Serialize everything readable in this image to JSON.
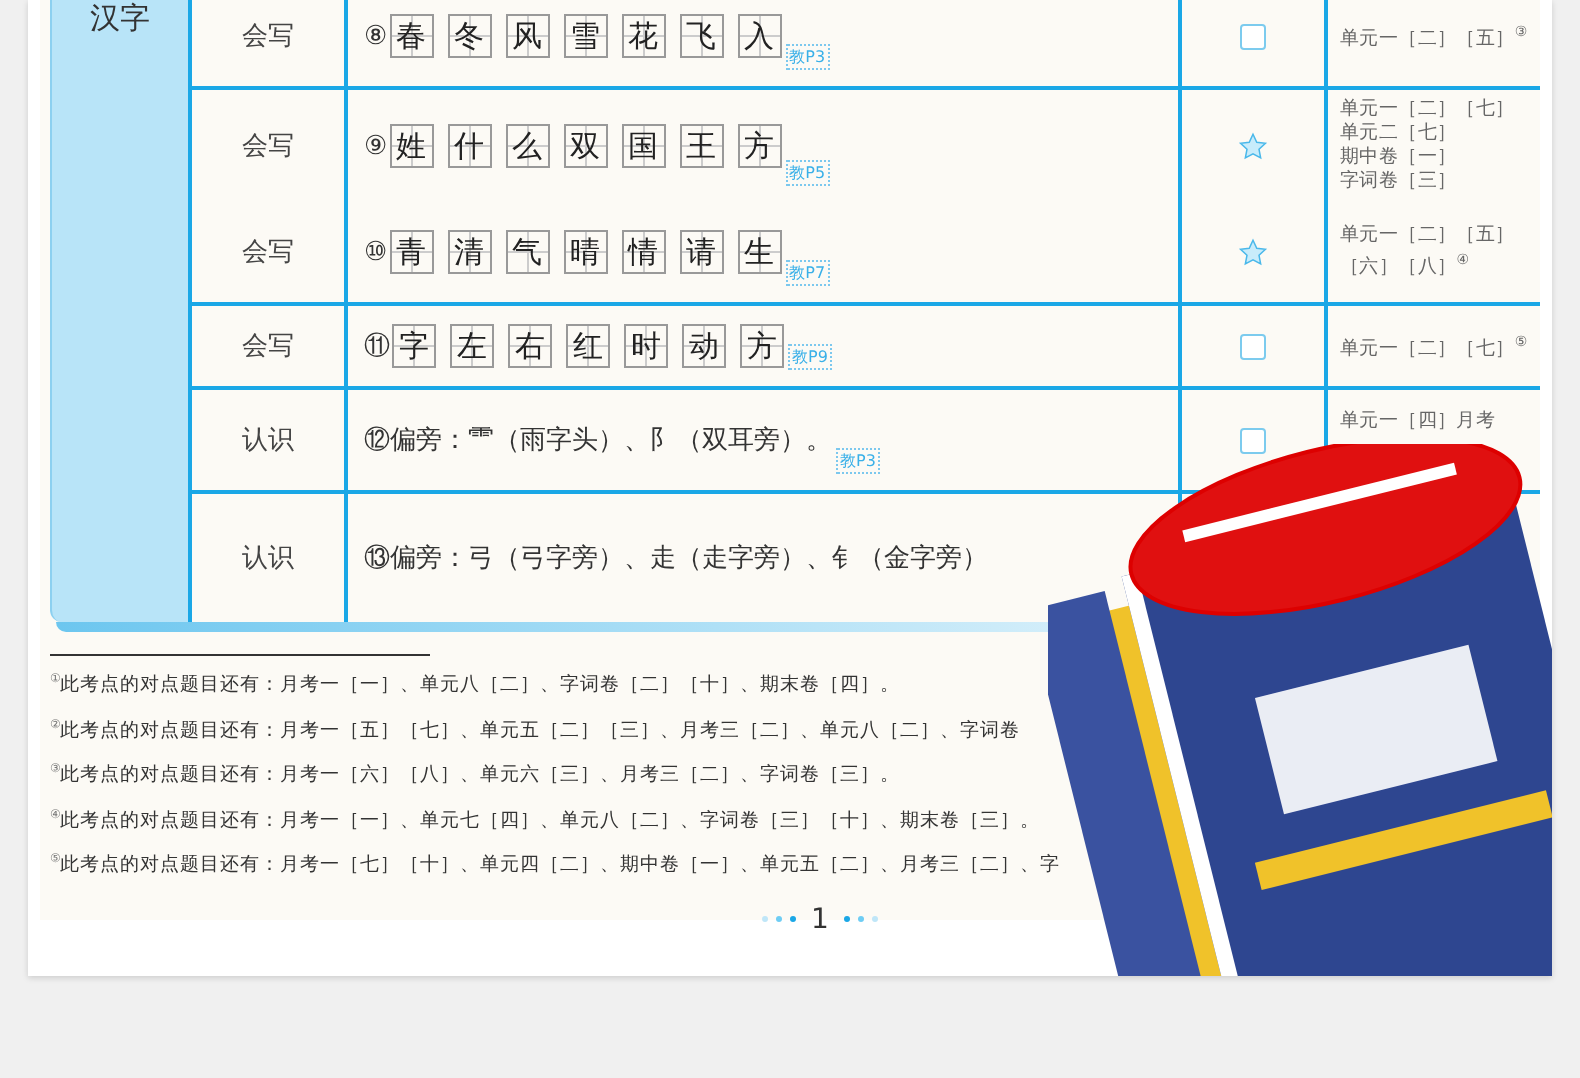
{
  "section": {
    "label": "汉字"
  },
  "groups": [
    {
      "rows": [
        {
          "type": "会写",
          "number": "⑧",
          "kind": "chars",
          "chars": [
            "春",
            "冬",
            "风",
            "雪",
            "花",
            "飞",
            "入"
          ],
          "page": "教P3",
          "starred": false,
          "refs": [
            "单元一［二］［五］$^{③}$"
          ]
        }
      ]
    },
    {
      "rows": [
        {
          "type": "会写",
          "number": "⑨",
          "kind": "chars",
          "chars": [
            "姓",
            "什",
            "么",
            "双",
            "国",
            "王",
            "方"
          ],
          "page": "教P5",
          "starred": true,
          "refs": [
            "单元一［二］［七］",
            "单元二［七］",
            "期中卷［一］",
            "字词卷［三］"
          ]
        },
        {
          "type": "会写",
          "number": "⑩",
          "kind": "chars",
          "chars": [
            "青",
            "清",
            "气",
            "晴",
            "情",
            "请",
            "生"
          ],
          "page": "教P7",
          "starred": true,
          "refs": [
            "单元一［二］［五］",
            "［六］［八］$^{④}$"
          ]
        }
      ]
    },
    {
      "rows": [
        {
          "type": "会写",
          "number": "⑪",
          "kind": "chars",
          "chars": [
            "字",
            "左",
            "右",
            "红",
            "时",
            "动",
            "方"
          ],
          "page": "教P9",
          "starred": false,
          "refs": [
            "单元一［二］［七］$^{⑤}$"
          ]
        }
      ]
    },
    {
      "rows": [
        {
          "type": "认识",
          "number": "⑫",
          "kind": "text",
          "text": "偏旁：⻗（雨字头）、阝（双耳旁）。",
          "page": "教P3",
          "starred": false,
          "refs": [
            "单元一［四］月考"
          ]
        }
      ]
    },
    {
      "rows": [
        {
          "type": "认识",
          "number": "⑬",
          "kind": "text",
          "text": "偏旁：弓（弓字旁）、走（走字旁）、钅（金字旁）",
          "refs": []
        }
      ]
    }
  ],
  "footnotes": [
    "$^{①}$此考点的对点题目还有：月考一［一］、单元八［二］、字词卷［二］［十］、期末卷［四］。",
    "$^{②}$此考点的对点题目还有：月考一［五］［七］、单元五［二］［三］、月考三［二］、单元八［二］、字词卷",
    "$^{③}$此考点的对点题目还有：月考一［六］［八］、单元六［三］、月考三［二］、字词卷［三］。",
    "$^{④}$此考点的对点题目还有：月考一［一］、单元七［四］、单元八［二］、字词卷［三］［十］、期末卷［三］。",
    "$^{⑤}$此考点的对点题目还有：月考一［七］［十］、单元四［二］、期中卷［一］、单元五［二］、月考三［二］、字"
  ],
  "page_number": "1"
}
